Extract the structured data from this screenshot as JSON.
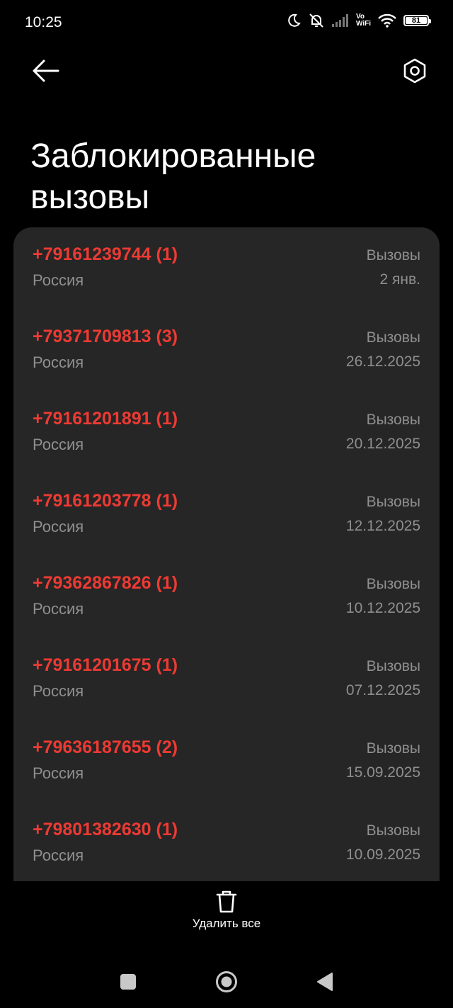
{
  "status_bar": {
    "time": "10:25",
    "vowifi": "Vo\nWiFi",
    "battery": "81"
  },
  "header": {
    "title": "Заблокированные вызовы"
  },
  "calls": [
    {
      "number": "+79161239744 (1)",
      "country": "Россия",
      "kind": "Вызовы",
      "date": "2 янв."
    },
    {
      "number": "+79371709813 (3)",
      "country": "Россия",
      "kind": "Вызовы",
      "date": "26.12.2025"
    },
    {
      "number": "+79161201891 (1)",
      "country": "Россия",
      "kind": "Вызовы",
      "date": "20.12.2025"
    },
    {
      "number": "+79161203778 (1)",
      "country": "Россия",
      "kind": "Вызовы",
      "date": "12.12.2025"
    },
    {
      "number": "+79362867826 (1)",
      "country": "Россия",
      "kind": "Вызовы",
      "date": "10.12.2025"
    },
    {
      "number": "+79161201675 (1)",
      "country": "Россия",
      "kind": "Вызовы",
      "date": "07.12.2025"
    },
    {
      "number": "+79636187655 (2)",
      "country": "Россия",
      "kind": "Вызовы",
      "date": "15.09.2025"
    },
    {
      "number": "+79801382630 (1)",
      "country": "Россия",
      "kind": "Вызовы",
      "date": "10.09.2025"
    }
  ],
  "footer": {
    "delete_all_label": "Удалить все"
  },
  "icons": {
    "back": "arrow-left-icon",
    "settings": "hexagon-gear-icon",
    "delete": "trash-icon",
    "nav_recents": "square-icon",
    "nav_home": "circle-icon",
    "nav_back": "triangle-icon"
  },
  "colors": {
    "background": "#000000",
    "card": "#262626",
    "blocked_number": "#ed3a33",
    "secondary_text": "#8f8f8f"
  }
}
